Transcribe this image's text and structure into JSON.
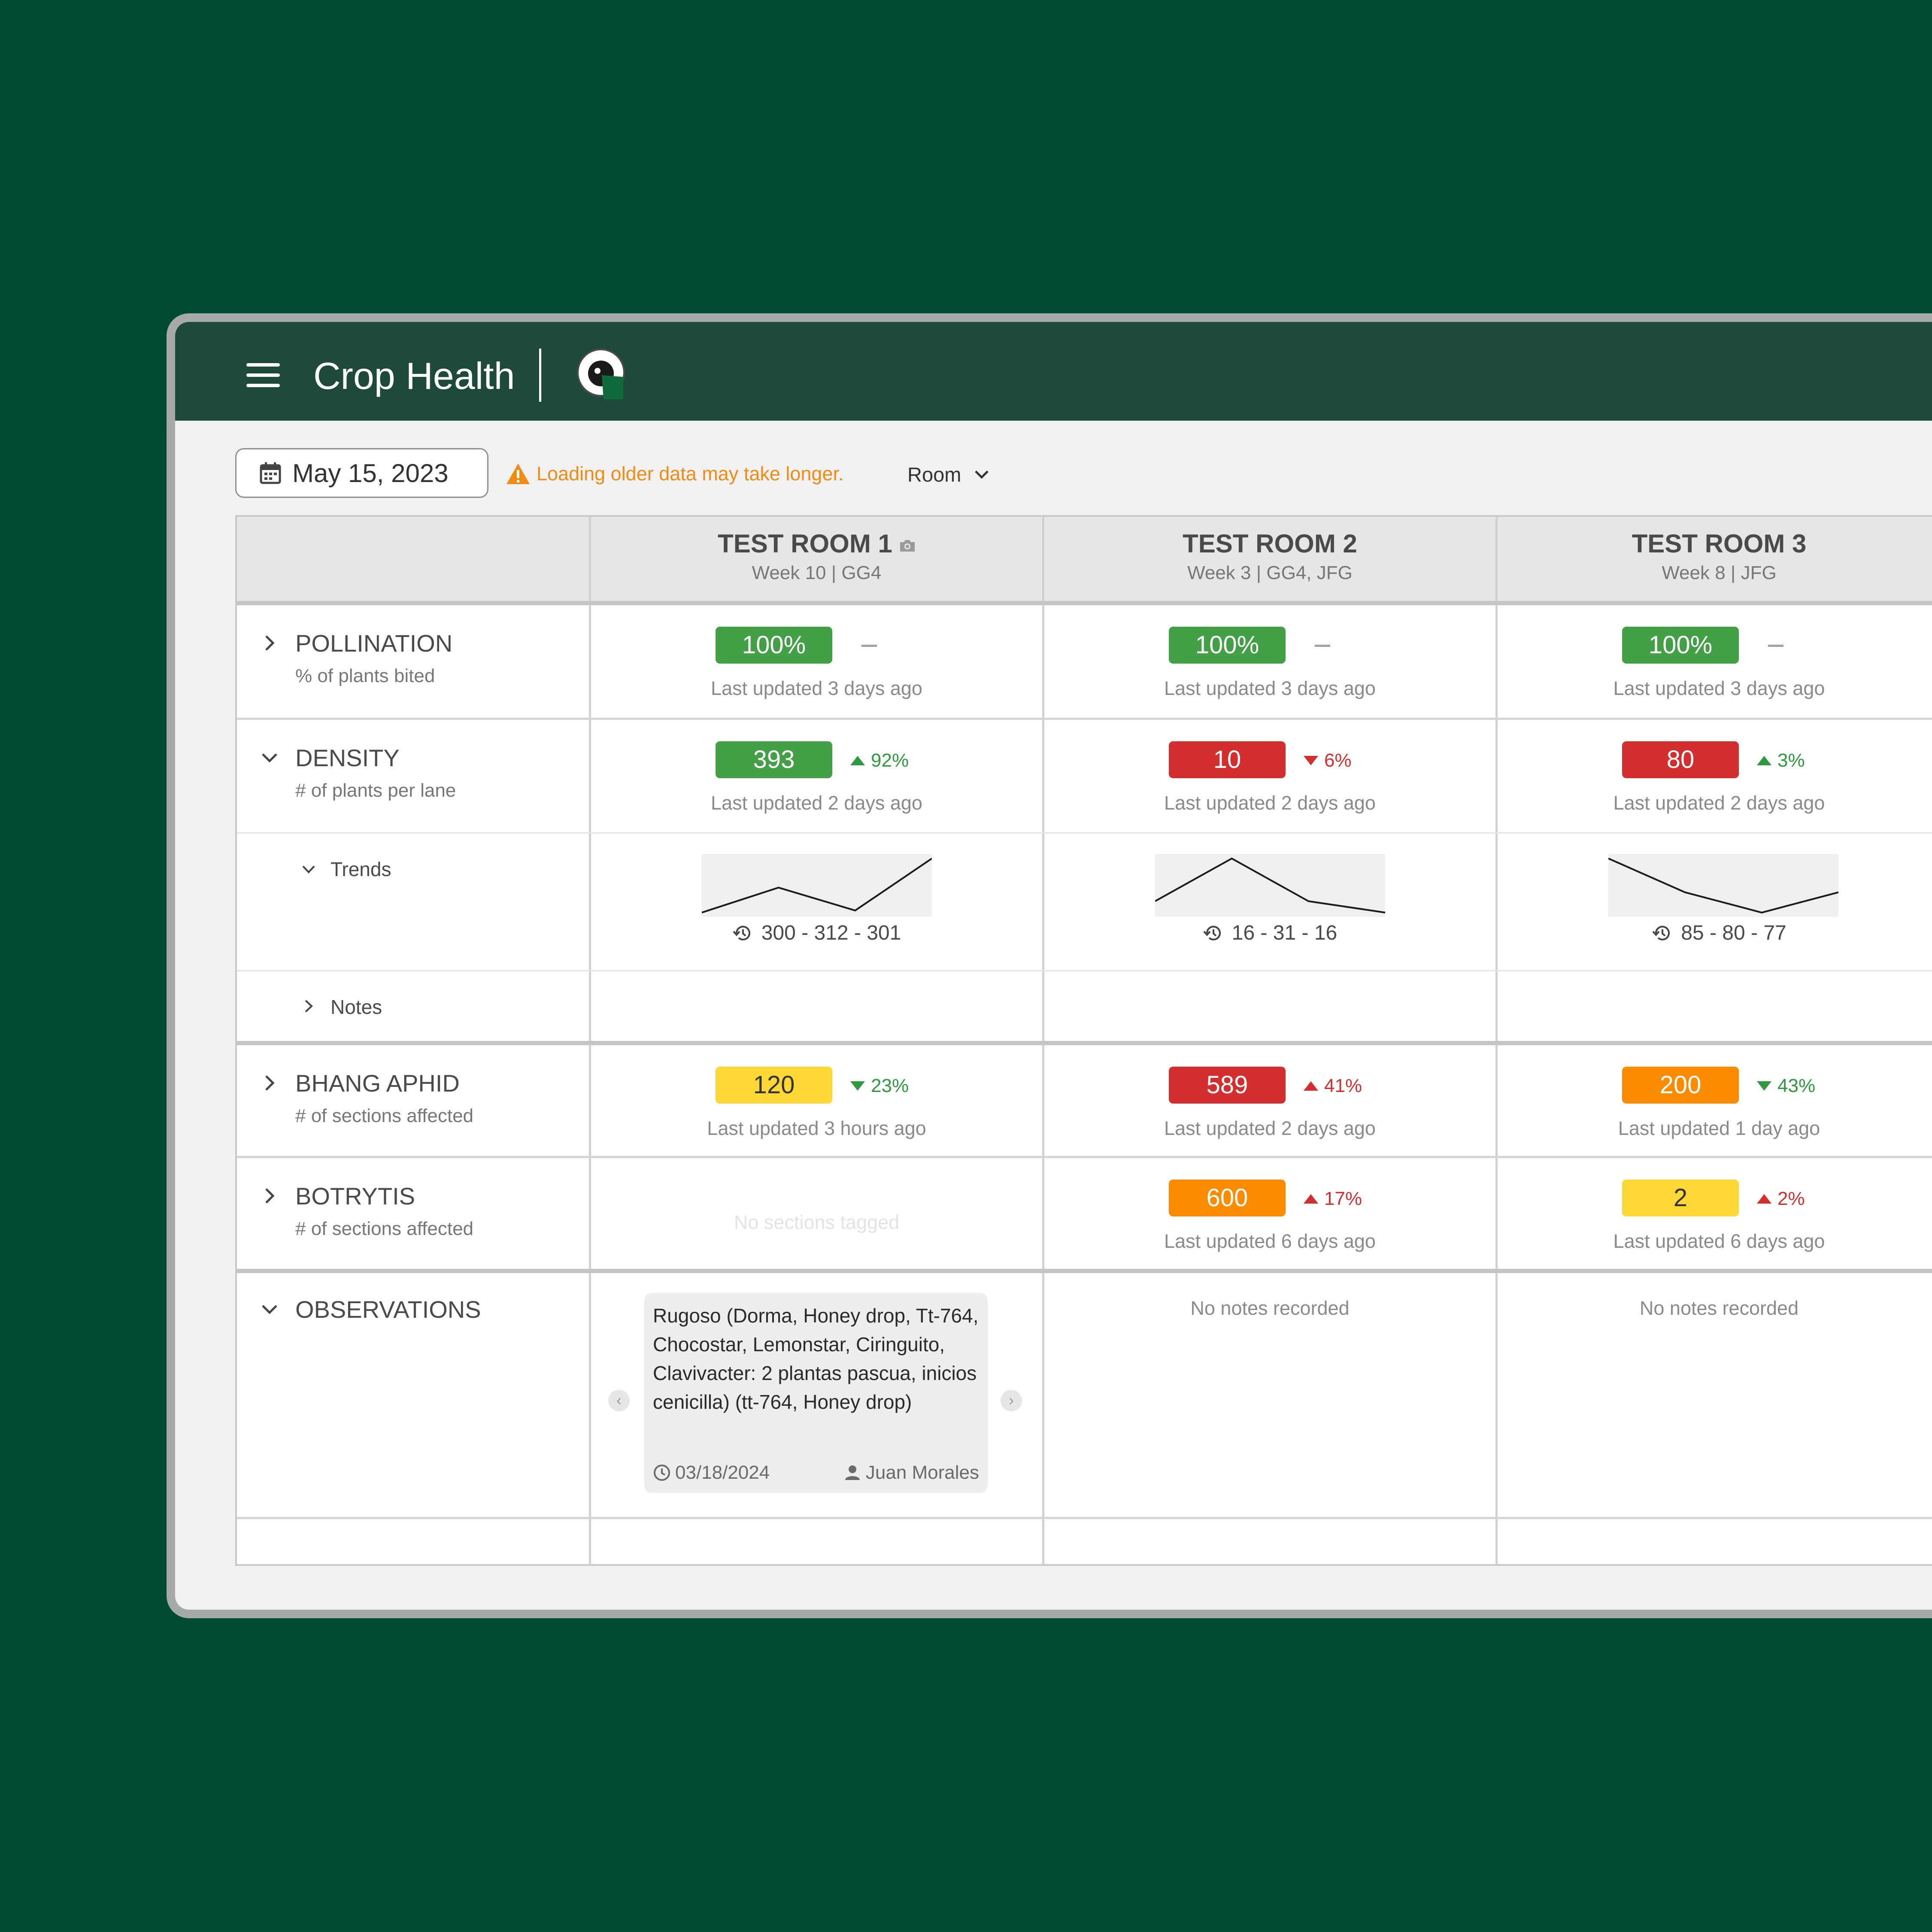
{
  "colors": {
    "background": "#004a33",
    "topbar": "#1d4a3b",
    "green": "#43a047",
    "red": "#d32f2f",
    "orange": "#fb8c00",
    "yellow": "#fdd835",
    "warning": "#f08c14",
    "delta_up_green": "#2e9a3e",
    "delta_red": "#d32f2f"
  },
  "app": {
    "title": "Crop Health"
  },
  "toolbar": {
    "date": "May 15, 2023",
    "warning": "Loading older data may take longer.",
    "group_by": "Room"
  },
  "rooms": [
    {
      "name": "TEST ROOM 1",
      "sub": "Week 10 | GG4",
      "has_camera": true
    },
    {
      "name": "TEST ROOM 2",
      "sub": "Week 3 | GG4, JFG"
    },
    {
      "name": "TEST ROOM 3",
      "sub": "Week 8 | JFG"
    }
  ],
  "metrics": {
    "pollination": {
      "label": "POLLINATION",
      "sub": "% of plants bited",
      "cells": [
        {
          "value": "100%",
          "color": "green",
          "delta": "–",
          "updated": "Last updated 3 days ago"
        },
        {
          "value": "100%",
          "color": "green",
          "delta": "–",
          "updated": "Last updated 3 days ago"
        },
        {
          "value": "100%",
          "color": "green",
          "delta": "–",
          "updated": "Last updated 3 days ago"
        }
      ]
    },
    "density": {
      "label": "DENSITY",
      "sub": "# of plants per lane",
      "cells": [
        {
          "value": "393",
          "color": "green",
          "delta": "92%",
          "direction": "up",
          "delta_color": "green",
          "updated": "Last updated 2 days ago"
        },
        {
          "value": "10",
          "color": "red",
          "delta": "6%",
          "direction": "down",
          "delta_color": "red",
          "updated": "Last updated 2 days ago"
        },
        {
          "value": "80",
          "color": "red",
          "delta": "3%",
          "direction": "up",
          "delta_color": "green",
          "updated": "Last updated 2 days ago"
        }
      ],
      "trends_label": "Trends",
      "notes_label": "Notes",
      "trends": [
        {
          "label": "300 - 312 - 301",
          "points": [
            300,
            312,
            301,
            326
          ]
        },
        {
          "label": "16 - 31 - 16",
          "points": [
            16,
            31,
            16,
            12
          ]
        },
        {
          "label": "85 - 80 - 77",
          "points": [
            85,
            80,
            77,
            80
          ]
        }
      ]
    },
    "bhang_aphid": {
      "label": "BHANG APHID",
      "sub": "# of sections affected",
      "cells": [
        {
          "value": "120",
          "color": "yellow",
          "delta": "23%",
          "direction": "down",
          "delta_color": "green",
          "updated": "Last updated 3 hours ago"
        },
        {
          "value": "589",
          "color": "red",
          "delta": "41%",
          "direction": "up",
          "delta_color": "red",
          "updated": "Last updated 2 days ago"
        },
        {
          "value": "200",
          "color": "orange",
          "delta": "43%",
          "direction": "down",
          "delta_color": "green",
          "updated": "Last updated 1 day ago"
        }
      ]
    },
    "botrytis": {
      "label": "BOTRYTIS",
      "sub": "# of sections affected",
      "empty_text": "No sections tagged",
      "cells": [
        null,
        {
          "value": "600",
          "color": "orange",
          "delta": "17%",
          "direction": "up",
          "delta_color": "red",
          "updated": "Last updated 6 days ago"
        },
        {
          "value": "2",
          "color": "yellow",
          "delta": "2%",
          "direction": "up",
          "delta_color": "red",
          "updated": "Last updated 6 days ago"
        }
      ]
    }
  },
  "observations": {
    "label": "OBSERVATIONS",
    "note": {
      "text": "Rugoso (Dorma, Honey drop, Tt-764, Chocostar, Lemonstar, Ciringuito, Clavivacter: 2 plantas pascua, inicios cenicilla) (tt-764, Honey drop)",
      "date": "03/18/2024",
      "author": "Juan Morales"
    },
    "empty_text": "No notes recorded"
  }
}
